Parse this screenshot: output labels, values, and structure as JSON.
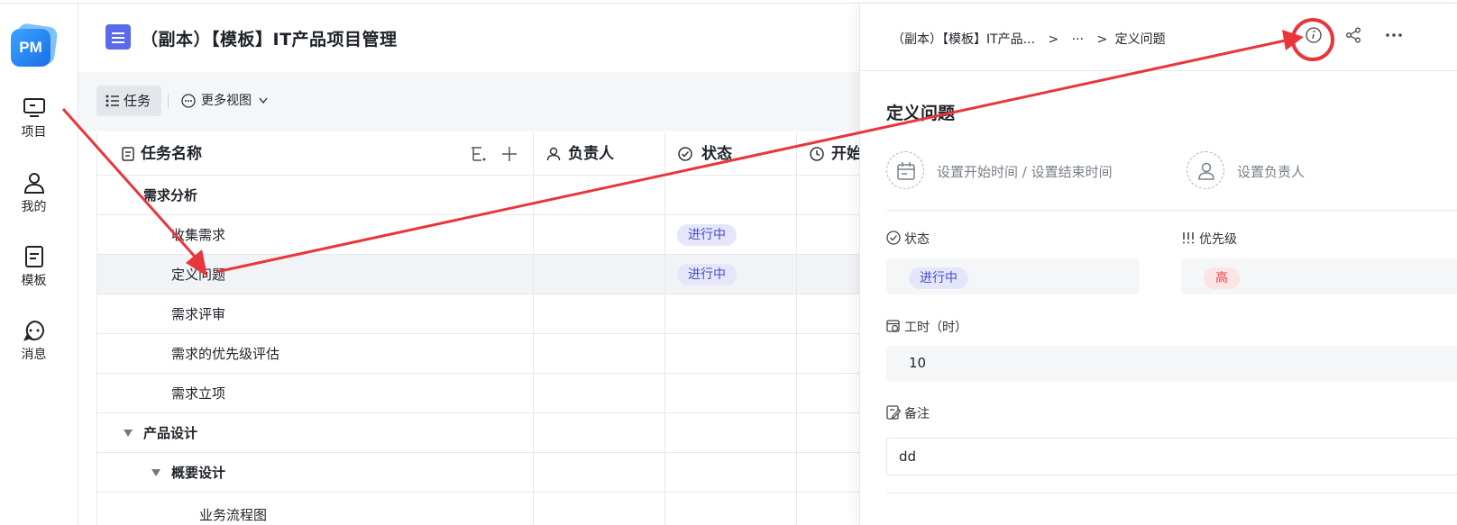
{
  "rail": {
    "logo_text": "PM",
    "items": [
      {
        "label": "项目",
        "icon": "monitor-icon"
      },
      {
        "label": "我的",
        "icon": "user-icon"
      },
      {
        "label": "模板",
        "icon": "template-icon"
      },
      {
        "label": "消息",
        "icon": "message-icon"
      }
    ]
  },
  "header": {
    "title": "（副本）【模板】IT产品项目管理"
  },
  "toolbar": {
    "task_tab": "任务",
    "more_views": "更多视图"
  },
  "table": {
    "columns": [
      "任务名称",
      "负责人",
      "状态",
      "开始"
    ],
    "rows": [
      {
        "name": "需求分析",
        "status": ""
      },
      {
        "name": "收集需求",
        "status": "进行中"
      },
      {
        "name": "定义问题",
        "status": "进行中"
      },
      {
        "name": "需求评审",
        "status": ""
      },
      {
        "name": "需求的优先级评估",
        "status": ""
      },
      {
        "name": "需求立项",
        "status": ""
      },
      {
        "name": "产品设计",
        "status": ""
      },
      {
        "name": "概要设计",
        "status": ""
      },
      {
        "name": "业务流程图",
        "status": ""
      }
    ]
  },
  "panel": {
    "breadcrumb": [
      "（副本）【模板】IT产品...",
      "···",
      "定义问题"
    ],
    "task_title": "定义问题",
    "time_hint": "设置开始时间 / 设置结束时间",
    "owner_hint": "设置负责人",
    "status_label": "状态",
    "status_value": "进行中",
    "priority_label": "优先级",
    "priority_value": "高",
    "hours_label": "工时（时）",
    "hours_value": "10",
    "notes_label": "备注",
    "notes_value": "dd"
  },
  "colors": {
    "accent": "#4a4dcc",
    "progress_tag_bg": "#e6e6fb",
    "high_tag_bg": "#fce4e4",
    "high_tag_text": "#e0454a",
    "annotation_red": "#e8363b"
  }
}
